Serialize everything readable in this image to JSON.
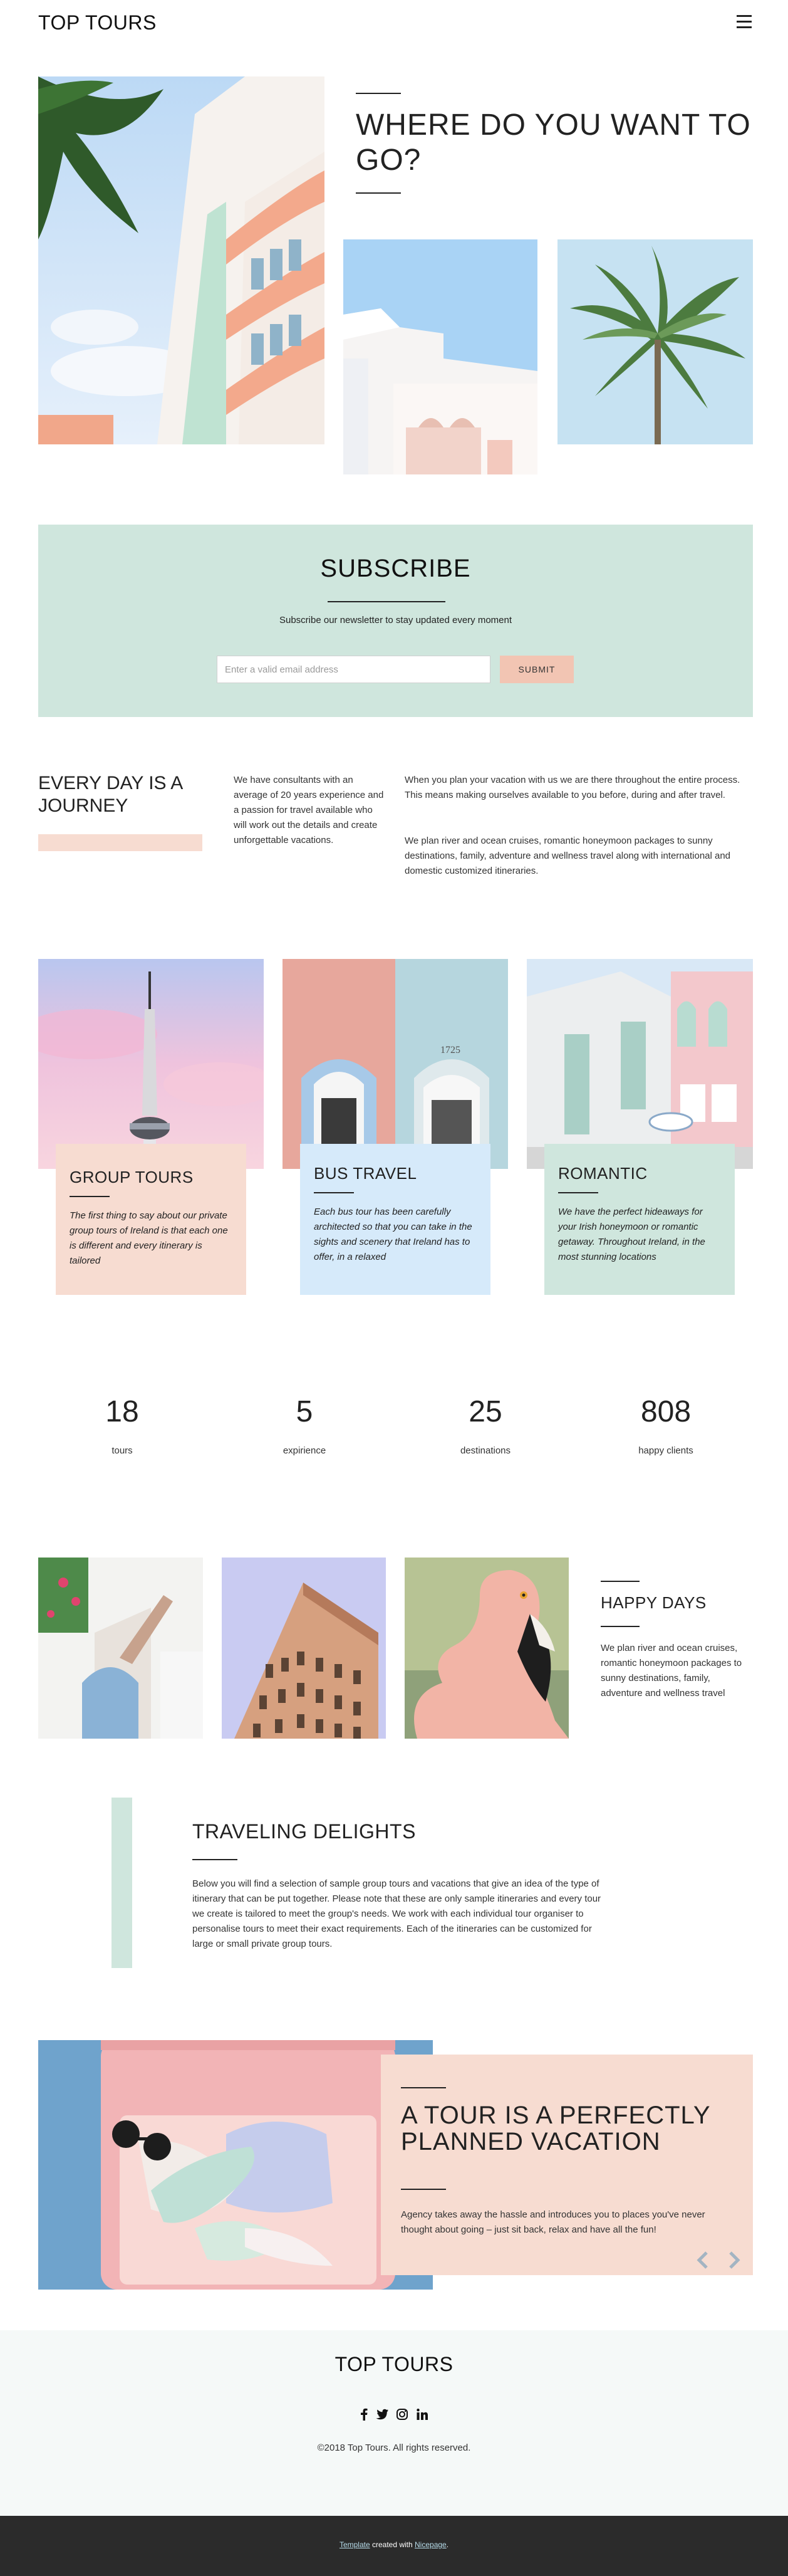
{
  "header": {
    "logo": "TOP TOURS",
    "menu_icon": "hamburger-menu-icon"
  },
  "hero": {
    "heading": "WHERE DO YOU WANT TO GO?"
  },
  "subscribe": {
    "title": "SUBSCRIBE",
    "text": "Subscribe our newsletter to stay updated every moment",
    "email_placeholder": "Enter a valid email address",
    "submit_label": "SUBMIT"
  },
  "journey": {
    "title": "EVERY DAY IS A JOURNEY",
    "col1": "We have consultants with an average of 20 years experience and a passion for travel available who will work out the details and create unforgettable vacations.",
    "col2_p1": "When you plan your vacation with us we are there throughout the entire process. This means making ourselves available to you before, during and after travel.",
    "col2_p2": "We plan river and ocean cruises, romantic honeymoon packages to sunny destinations, family, adventure and wellness travel along with international and domestic customized itineraries."
  },
  "tours": [
    {
      "title": "GROUP TOURS",
      "text": "The first thing to say about our private group tours of Ireland is that each one is different and every itinerary is tailored",
      "color": "#f7dcd1"
    },
    {
      "title": "BUS TRAVEL",
      "text": "Each bus tour has been carefully architected so that you can take in the sights and scenery that Ireland has to offer, in a relaxed",
      "color": "#d6eafa"
    },
    {
      "title": "ROMANTIC",
      "text": "We have the perfect hideaways for your Irish honeymoon or romantic getaway. Throughout Ireland, in the most stunning locations",
      "color": "#cfe6dd"
    }
  ],
  "stats": [
    {
      "number": "18",
      "label": "tours"
    },
    {
      "number": "5",
      "label": "expirience"
    },
    {
      "number": "25",
      "label": "destinations"
    },
    {
      "number": "808",
      "label": "happy clients"
    }
  ],
  "happy": {
    "title": "HAPPY DAYS",
    "text": "We plan river and ocean cruises, romantic honeymoon packages to sunny destinations, family, adventure and wellness travel"
  },
  "traveling": {
    "title": "TRAVELING DELIGHTS",
    "text": "Below you will find a selection of sample group tours and vacations that give an idea of the type of itinerary that can be put together. Please note that these are only sample itineraries and every tour we create is tailored to meet the group's needs. We work with each individual tour organiser to personalise tours to meet their exact requirements. Each of the itineraries can be customized for large or small private group tours."
  },
  "vacation": {
    "title": "A TOUR IS A PERFECTLY PLANNED VACATION",
    "text": "Agency takes away the hassle and introduces you to places you've never thought about going – just sit back, relax and have all the fun!"
  },
  "footer": {
    "title": "TOP TOURS",
    "socials": [
      "facebook-icon",
      "twitter-icon",
      "instagram-icon",
      "linkedin-icon"
    ],
    "copyright": "©2018 Top Tours. All rights reserved.",
    "credit_template": "Template",
    "credit_middle": " created with ",
    "credit_builder": "Nicepage",
    "credit_end": "."
  },
  "colors": {
    "mint": "#cfe6dd",
    "peach": "#f7dcd1",
    "sky": "#d6eafa",
    "button": "#f2c5b3",
    "dark": "#2b2b2b"
  }
}
